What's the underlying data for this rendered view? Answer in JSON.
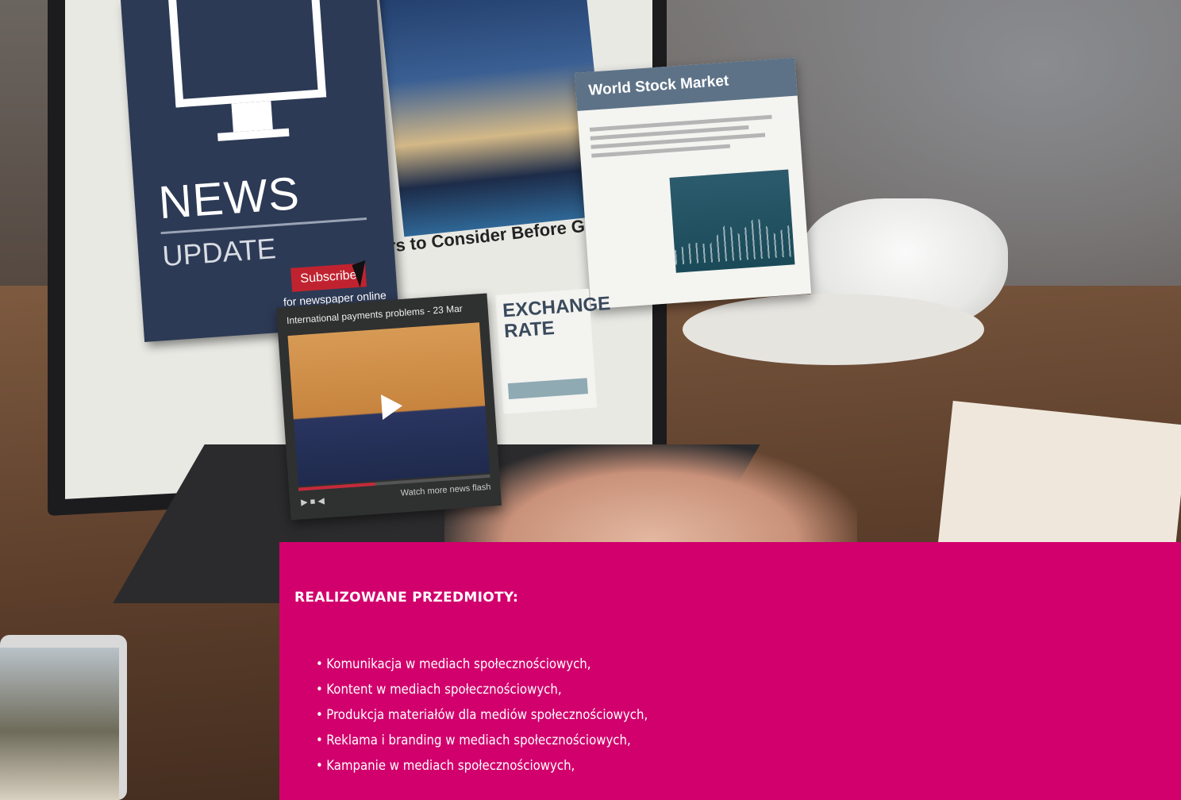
{
  "screen": {
    "news_card": {
      "title": "NEWS",
      "subtitle": "UPDATE",
      "subscribe_label": "Subscribe",
      "tagline": "for newspaper online"
    },
    "headline": "tors to Consider Before Going Glob",
    "stock_panel": {
      "title": "World Stock Market"
    },
    "video_player": {
      "title": "International payments problems - 23 Mar",
      "more_link": "Watch more news flash",
      "controls": "▶ ■ ◀"
    },
    "exchange_box": {
      "title": "EXCHANGE RATE"
    }
  },
  "panel": {
    "heading": "REALIZOWANE PRZEDMIOTY:",
    "items": [
      "Komunikacja w mediach społecznościowych,",
      "Kontent w mediach społecznościowych,",
      "Produkcja materiałów dla mediów społecznościowych,",
      "Reklama i branding w mediach społecznościowych,",
      "Kampanie w mediach społecznościowych,"
    ],
    "background_color": "#d2006c"
  }
}
